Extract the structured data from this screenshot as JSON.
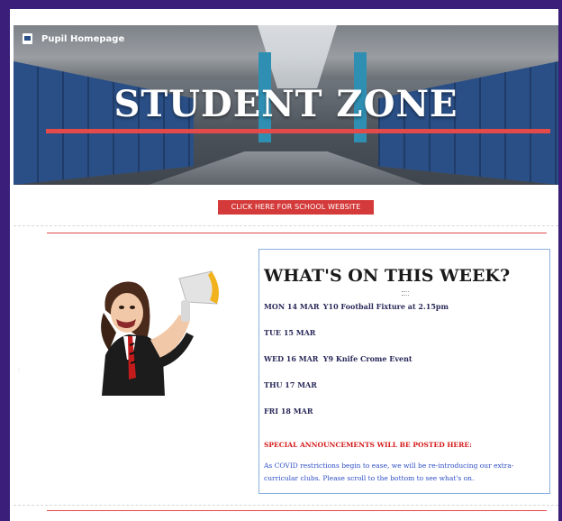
{
  "header": {
    "brand_label": "Pupil Homepage",
    "brand_icon": "school-crest-icon",
    "hero_title": "STUDENT ZONE"
  },
  "cta": {
    "label": "CLICK HERE FOR SCHOOL WEBSITE"
  },
  "events": {
    "heading": "WHAT'S ON THIS WEEK?",
    "days": [
      {
        "day": "MON 14 MAR",
        "event": "Y10 Football Fixture at 2.15pm"
      },
      {
        "day": "TUE 15 MAR",
        "event": ""
      },
      {
        "day": "WED 16 MAR",
        "event": "Y9 Knife Crome Event"
      },
      {
        "day": "THU 17 MAR",
        "event": ""
      },
      {
        "day": "FRI 18 MAR",
        "event": ""
      }
    ],
    "announcement": "SPECIAL  ANNOUNCEMENTS WILL BE POSTED HERE:",
    "note": "As  COVID restrictions begin to ease, we will be re-introducing our extra-curricular clubs. Please scroll to the bottom to see what's on."
  },
  "colors": {
    "frame": "#3a1e7a",
    "accent_red": "#d43a3a",
    "box_border": "#8ab0e0",
    "note_blue": "#2e4fc4"
  }
}
